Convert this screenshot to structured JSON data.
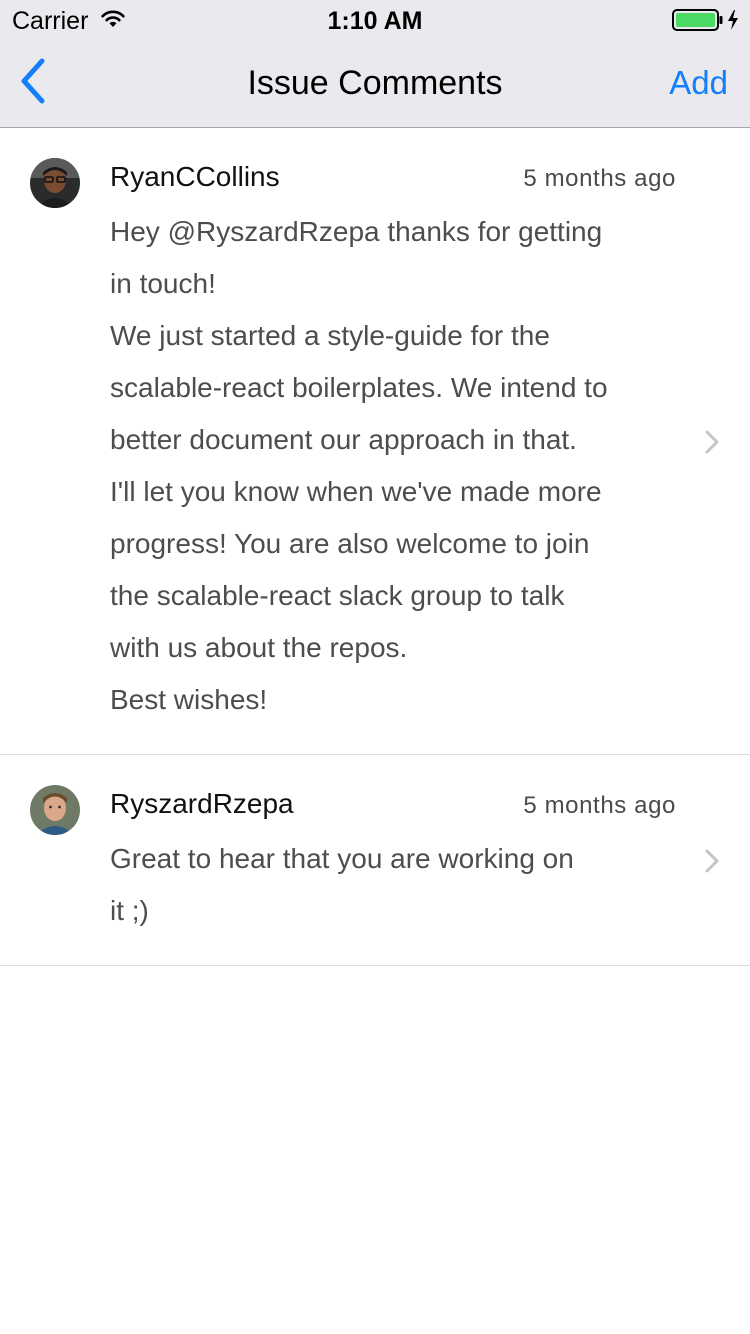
{
  "status_bar": {
    "carrier": "Carrier",
    "time": "1:10 AM",
    "icons": [
      "wifi-icon",
      "battery-charging-icon"
    ]
  },
  "nav": {
    "back_icon": "chevron-left-icon",
    "title": "Issue Comments",
    "add_label": "Add"
  },
  "comments": [
    {
      "author": "RyanCCollins",
      "timestamp": "5 months ago",
      "body": "Hey @RyszardRzepa thanks for getting\nin touch!\nWe just started a style-guide for the\nscalable-react boilerplates.  We intend to\nbetter document our approach in that.\nI'll let you know when we've made more\nprogress!  You are also welcome to join\nthe scalable-react slack group to talk\nwith us about the repos.\nBest wishes!"
    },
    {
      "author": "RyszardRzepa",
      "timestamp": "5 months ago",
      "body": "Great to hear that you are working on\nit ;)"
    }
  ],
  "colors": {
    "accent": "#147efb",
    "bar_background": "#eaeaee",
    "battery": "#4cd964",
    "separator": "#dcdcdc",
    "body_text": "#4d4d4d"
  }
}
